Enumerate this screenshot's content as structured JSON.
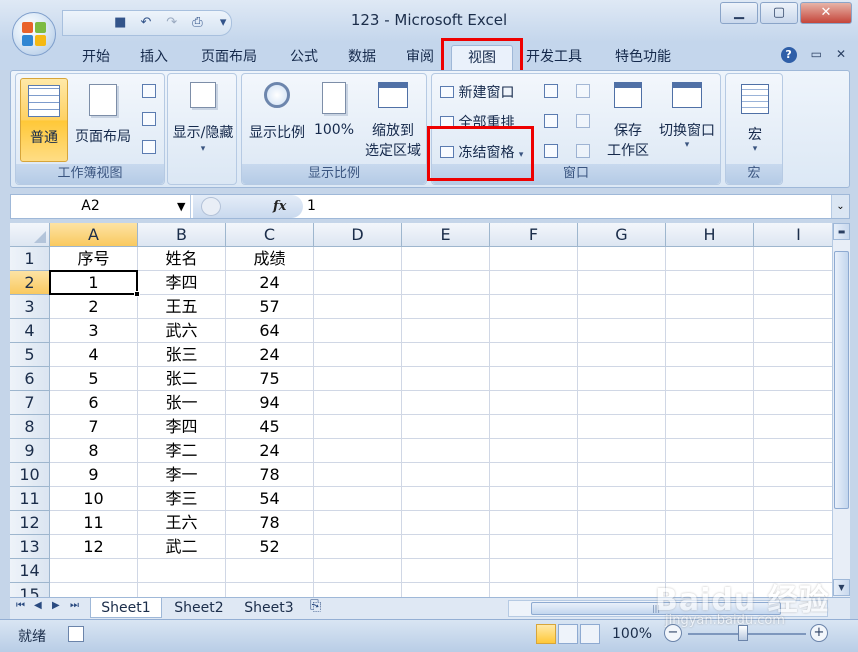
{
  "window": {
    "title": "123 - Microsoft Excel"
  },
  "qat": {
    "icons": [
      "save-icon",
      "undo-icon",
      "redo-icon",
      "print-preview-icon",
      "customize-qat-icon"
    ]
  },
  "tabs": [
    "开始",
    "插入",
    "页面布局",
    "公式",
    "数据",
    "审阅",
    "视图",
    "开发工具",
    "特色功能"
  ],
  "active_tab": "视图",
  "ribbon": {
    "workbook_views": {
      "label": "工作簿视图",
      "normal": "普通",
      "page_layout": "页面布局"
    },
    "show_hide": {
      "label": "显示/隐藏"
    },
    "zoom": {
      "label": "显示比例",
      "zoom": "显示比例",
      "hundred": "100%",
      "zoom_selection_1": "缩放到",
      "zoom_selection_2": "选定区域"
    },
    "window": {
      "label": "窗口",
      "new_window": "新建窗口",
      "arrange_all": "全部重排",
      "freeze_panes": "冻结窗格",
      "save_workspace_1": "保存",
      "save_workspace_2": "工作区",
      "switch_windows": "切换窗口"
    },
    "macros": {
      "label": "宏",
      "macros": "宏"
    }
  },
  "formula_bar": {
    "name_box": "A2",
    "fx": "fx",
    "value": "1"
  },
  "columns": [
    "A",
    "B",
    "C",
    "D",
    "E",
    "F",
    "G",
    "H",
    "I"
  ],
  "rows": [
    [
      "序号",
      "姓名",
      "成绩"
    ],
    [
      "1",
      "李四",
      "24"
    ],
    [
      "2",
      "王五",
      "57"
    ],
    [
      "3",
      "武六",
      "64"
    ],
    [
      "4",
      "张三",
      "24"
    ],
    [
      "5",
      "张二",
      "75"
    ],
    [
      "6",
      "张一",
      "94"
    ],
    [
      "7",
      "李四",
      "45"
    ],
    [
      "8",
      "李二",
      "24"
    ],
    [
      "9",
      "李一",
      "78"
    ],
    [
      "10",
      "李三",
      "54"
    ],
    [
      "11",
      "王六",
      "78"
    ],
    [
      "12",
      "武二",
      "52"
    ],
    [
      "",
      "",
      ""
    ],
    [
      "",
      "",
      ""
    ]
  ],
  "sheets": [
    "Sheet1",
    "Sheet2",
    "Sheet3"
  ],
  "status": {
    "ready": "就绪",
    "zoom": "100%"
  },
  "watermark": {
    "main": "Baidu 经验",
    "sub": "jingyan.baidu.com"
  },
  "colors": {
    "highlight_red": "#e00000",
    "ribbon_bg": "#dce8f5",
    "selected_header": "#f9c95f"
  }
}
